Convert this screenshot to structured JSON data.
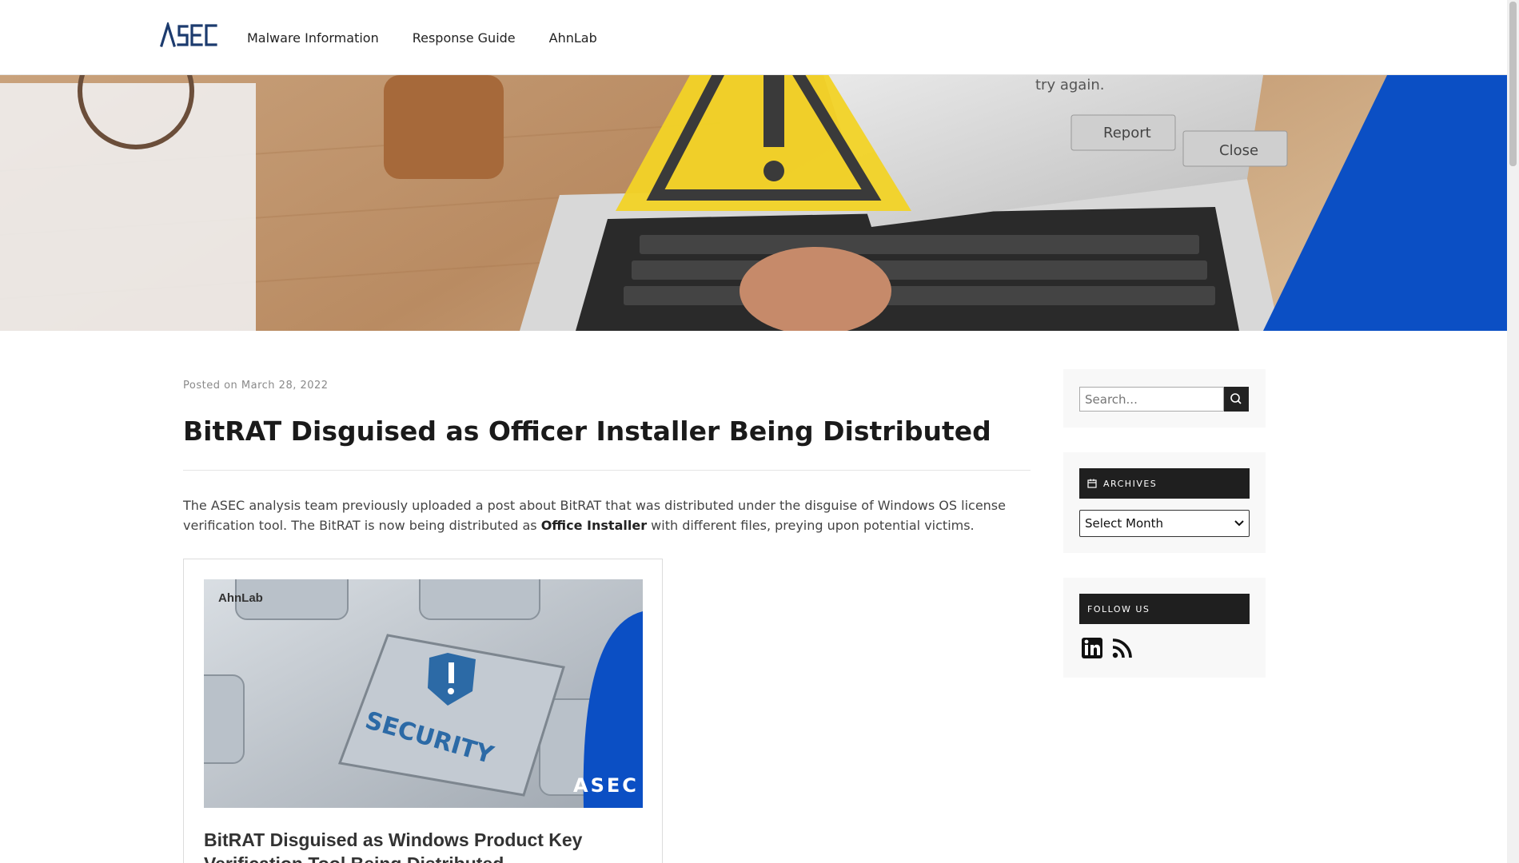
{
  "brand": {
    "logo_text": "ASEC"
  },
  "nav": {
    "items": [
      {
        "label": "Malware Information"
      },
      {
        "label": "Response Guide"
      },
      {
        "label": "AhnLab"
      }
    ]
  },
  "hero": {
    "dialog_text": "try again.",
    "report_button": "Report",
    "close_button": "Close"
  },
  "post": {
    "posted_prefix": "Posted on",
    "date": "March 28, 2022",
    "title": "BitRAT Disguised as Officer Installer Being Distributed",
    "intro_part1": "The ASEC analysis team previously uploaded a post about BitRAT that was distributed under the disguise of Windows OS license verification tool. The BitRAT is now being distributed as ",
    "intro_bold": "Office Installer",
    "intro_part2": " with different files, preying upon potential victims."
  },
  "link_card": {
    "thumb_brand": "AhnLab",
    "thumb_key_text": "SECURITY",
    "thumb_logo": "ASEC",
    "title": "BitRAT Disguised as Windows Product Key Verification Tool Being Distributed"
  },
  "sidebar": {
    "search": {
      "placeholder": "Search..."
    },
    "archives": {
      "title": "ARCHIVES",
      "selected": "Select Month"
    },
    "follow": {
      "title": "FOLLOW US",
      "icons": [
        "linkedin-icon",
        "rss-icon"
      ]
    }
  },
  "colors": {
    "brand_navy": "#1c3b6e",
    "hero_blue": "#0b4fc4",
    "warning_yellow": "#f2d326",
    "widget_dark": "#1f1f1f"
  }
}
